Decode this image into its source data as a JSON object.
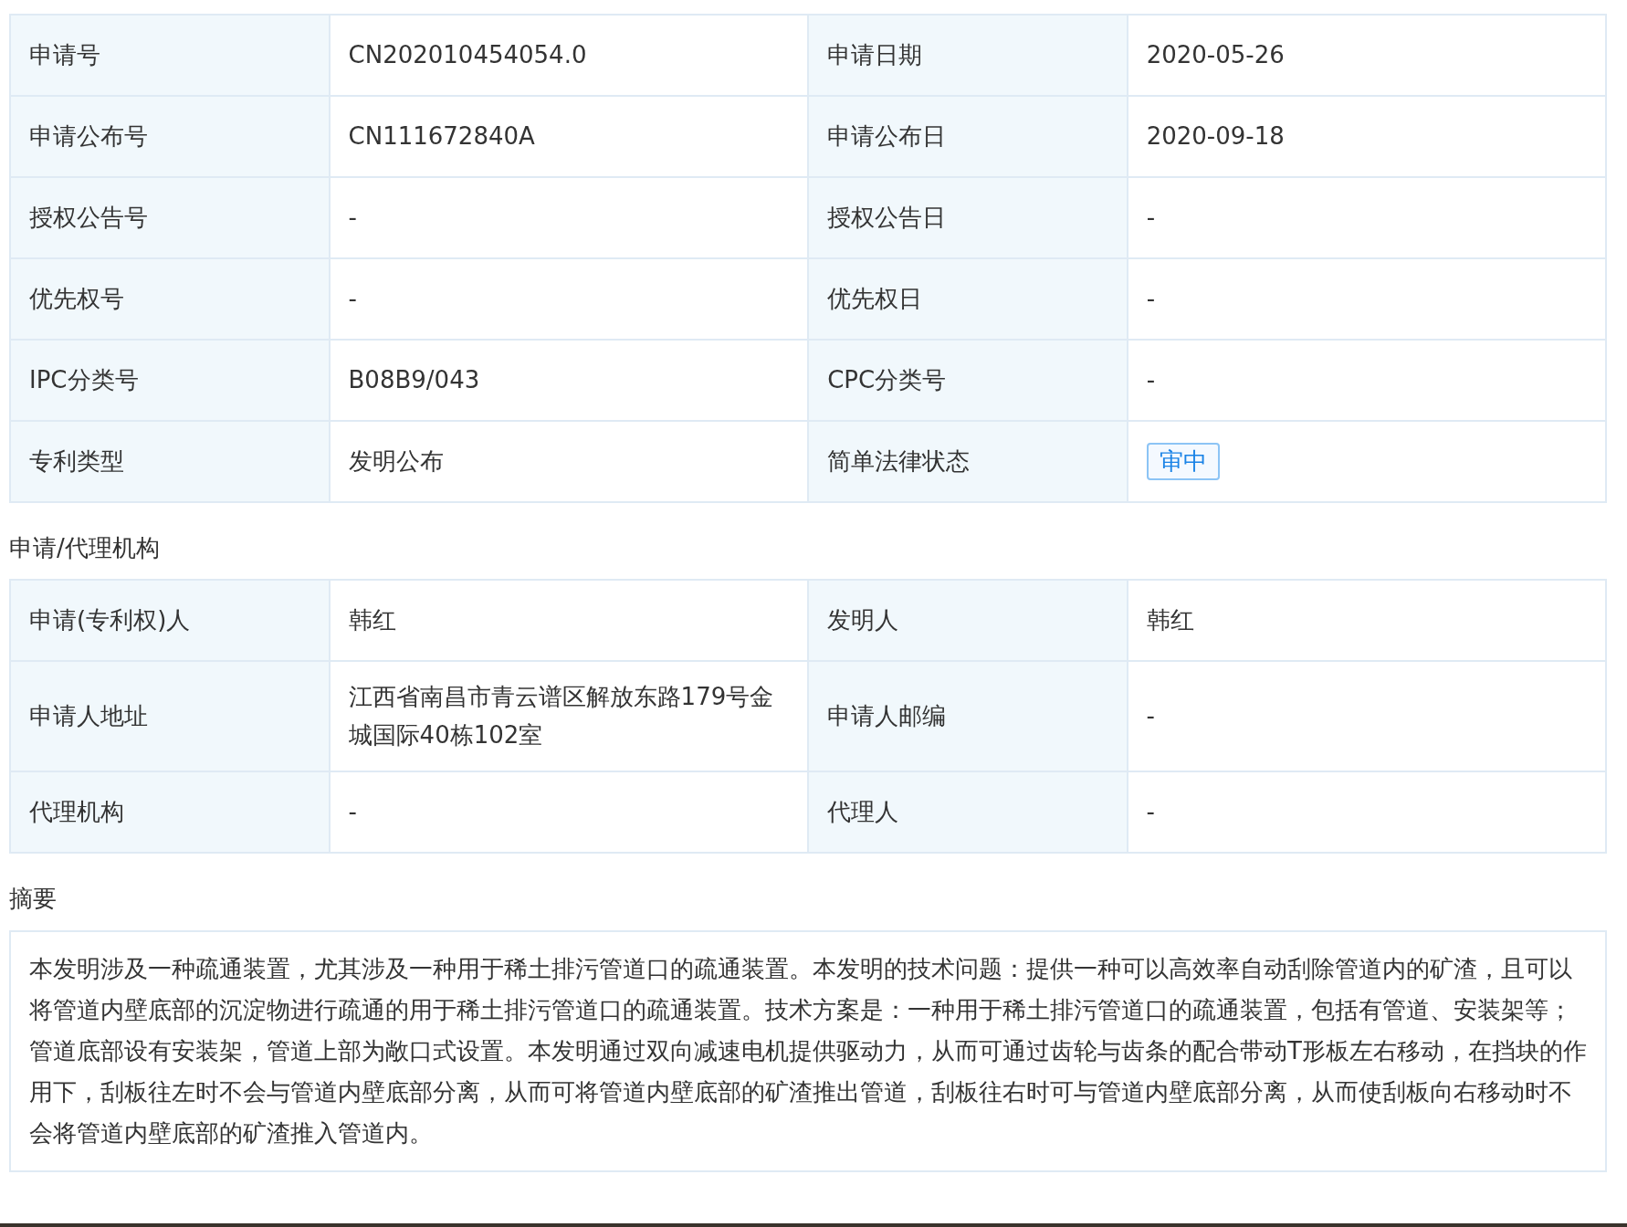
{
  "basic_info": {
    "rows": [
      [
        {
          "label": "申请号",
          "value": "CN202010454054.0",
          "kind": "text"
        },
        {
          "label": "申请日期",
          "value": "2020-05-26",
          "kind": "text"
        }
      ],
      [
        {
          "label": "申请公布号",
          "value": "CN111672840A",
          "kind": "text"
        },
        {
          "label": "申请公布日",
          "value": "2020-09-18",
          "kind": "text"
        }
      ],
      [
        {
          "label": "授权公告号",
          "value": "-",
          "kind": "text"
        },
        {
          "label": "授权公告日",
          "value": "-",
          "kind": "text"
        }
      ],
      [
        {
          "label": "优先权号",
          "value": "-",
          "kind": "text"
        },
        {
          "label": "优先权日",
          "value": "-",
          "kind": "text"
        }
      ],
      [
        {
          "label": "IPC分类号",
          "value": "B08B9/043",
          "kind": "text"
        },
        {
          "label": "CPC分类号",
          "value": "-",
          "kind": "text"
        }
      ],
      [
        {
          "label": "专利类型",
          "value": "发明公布",
          "kind": "text"
        },
        {
          "label": "简单法律状态",
          "value": "审中",
          "kind": "status"
        }
      ]
    ]
  },
  "applicant_section": {
    "heading": "申请/代理机构",
    "rows": [
      [
        {
          "label": "申请(专利权)人",
          "value": "韩红",
          "kind": "text"
        },
        {
          "label": "发明人",
          "value": "韩红",
          "kind": "text"
        }
      ],
      [
        {
          "label": "申请人地址",
          "value": "江西省南昌市青云谱区解放东路179号金城国际40栋102室",
          "kind": "text"
        },
        {
          "label": "申请人邮编",
          "value": "-",
          "kind": "text"
        }
      ],
      [
        {
          "label": "代理机构",
          "value": "-",
          "kind": "text"
        },
        {
          "label": "代理人",
          "value": "-",
          "kind": "text"
        }
      ]
    ]
  },
  "abstract": {
    "heading": "摘要",
    "text": "本发明涉及一种疏通装置，尤其涉及一种用于稀土排污管道口的疏通装置。本发明的技术问题：提供一种可以高效率自动刮除管道内的矿渣，且可以将管道内壁底部的沉淀物进行疏通的用于稀土排污管道口的疏通装置。技术方案是：一种用于稀土排污管道口的疏通装置，包括有管道、安装架等；管道底部设有安装架，管道上部为敞口式设置。本发明通过双向减速电机提供驱动力，从而可通过齿轮与齿条的配合带动T形板左右移动，在挡块的作用下，刮板往左时不会与管道内壁底部分离，从而可将管道内壁底部的矿渣推出管道，刮板往右时可与管道内壁底部分离，从而使刮板向右移动时不会将管道内壁底部的矿渣推入管道内。"
  }
}
